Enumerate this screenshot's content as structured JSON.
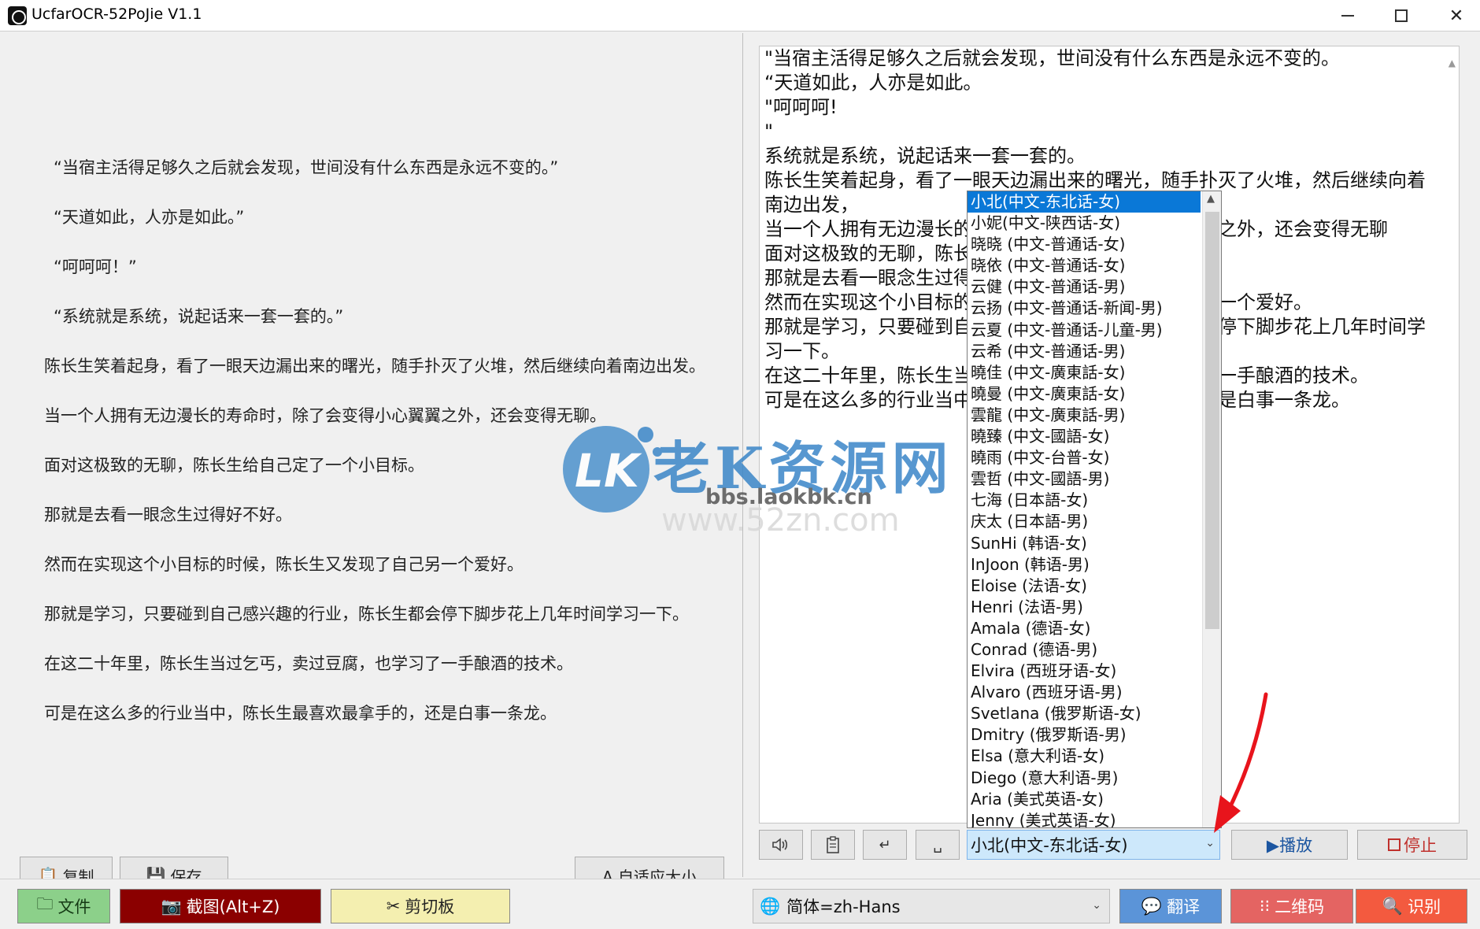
{
  "window": {
    "title": "UcfarOCR-52PoJie V1.1",
    "controls": [
      "minimize",
      "maximize",
      "close"
    ]
  },
  "left_panel": {
    "paragraphs": [
      "“当宿主活得足够久之后就会发现，世间没有什么东西是永远不变的。”",
      "“天道如此，人亦是如此。”",
      "“呵呵呵！”",
      "“系统就是系统，说起话来一套一套的。”",
      "陈长生笑着起身，看了一眼天边漏出来的曙光，随手扑灭了火堆，然后继续向着南边出发。",
      "当一个人拥有无边漫长的寿命时，除了会变得小心翼翼之外，还会变得无聊。",
      "面对这极致的无聊，陈长生给自己定了一个小目标。",
      "那就是去看一眼念生过得好不好。",
      "然而在实现这个小目标的时候，陈长生又发现了自己另一个爱好。",
      "那就是学习，只要碰到自己感兴趣的行业，陈长生都会停下脚步花上几年时间学习一下。",
      "在这二十年里，陈长生当过乞丐，卖过豆腐，也学习了一手酿酒的技术。",
      "可是在这么多的行业当中，陈长生最喜欢最拿手的，还是白事一条龙。"
    ],
    "buttons": {
      "copy": "复制",
      "save": "保存",
      "more": "...",
      "autofit": "A 自适应大小"
    }
  },
  "right_panel": {
    "lines": [
      "\"当宿主活得足够久之后就会发现，世间没有什么东西是永远不变的。",
      "“天道如此，人亦是如此。",
      "\"呵呵呵!",
      "\"",
      "系统就是系统，说起话来一套一套的。",
      "陈长生笑着起身，看了一眼天边漏出来的曙光，随手扑灭了火堆，然后继续向着",
      "南边出发，",
      "当一个人拥有无边漫长的寿命时，除了会变得小心翼翼之外，还会变得无聊",
      "面对这极致的无聊，陈长生给自己定了一个小目标。",
      "那就是去看一眼念生过得好不好。",
      "然而在实现这个小目标的时候，陈长生又发现了自己另一个爱好。",
      "那就是学习，只要碰到自己感兴趣的行业，陈长生都会停下脚步花上几年时间学",
      "习一下。",
      "在这二十年里，陈长生当过乞丐，卖过豆腐，也学习了一手酿酒的技术。",
      "可是在这么多的行业当中，陈长生最喜欢最拿手的，还是白事一条龙。"
    ],
    "toolbar": {
      "speaker_icon": "speaker-icon",
      "clipboard_icon": "clipboard-icon",
      "enter_glyph": "↵",
      "space_glyph": "␣",
      "voice_selected": "小北(中文-东北话-女)",
      "play": "▶播放",
      "stop": "停止"
    },
    "voice_options": [
      "小北(中文-东北话-女)",
      "小妮(中文-陕西话-女)",
      "晓晓 (中文-普通话-女)",
      "晓依 (中文-普通话-女)",
      "云健 (中文-普通话-男)",
      "云扬 (中文-普通话-新闻-男)",
      "云夏 (中文-普通话-儿童-男)",
      "云希 (中文-普通话-男)",
      "曉佳 (中文-廣東話-女)",
      "曉曼 (中文-廣東話-女)",
      "雲龍 (中文-廣東話-男)",
      "曉臻 (中文-國語-女)",
      "曉雨 (中文-台普-女)",
      "雲哲 (中文-國語-男)",
      "七海 (日本語-女)",
      "庆太 (日本語-男)",
      "SunHi (韩语-女)",
      "InJoon (韩语-男)",
      "Eloise (法语-女)",
      "Henri (法语-男)",
      "Amala (德语-女)",
      "Conrad (德语-男)",
      "Elvira (西班牙语-女)",
      "Alvaro (西班牙语-男)",
      "Svetlana (俄罗斯语-女)",
      "Dmitry (俄罗斯语-男)",
      "Elsa (意大利语-女)",
      "Diego (意大利语-男)",
      "Aria (美式英语-女)",
      "Jenny (美式英语-女)"
    ]
  },
  "watermark": {
    "logo": "LK",
    "name": "老K资源网",
    "url": "bbs.laokbk.cn",
    "url2": "www.52zn.com"
  },
  "bottom_bar": {
    "file": "文件",
    "screenshot": "截图(Alt+Z)",
    "clipboard": "剪切板",
    "language": "简体=zh-Hans",
    "translate": "翻译",
    "qrcode": "二维码",
    "recognize": "识别"
  },
  "colors": {
    "selection": "#0a78d7",
    "file_btn": "#8cd08a",
    "screenshot_btn": "#8b0000",
    "clipboard_btn": "#f4efb0",
    "translate_btn": "#5b94d8",
    "qrcode_btn": "#e46462",
    "recognize_btn": "#f35a3f",
    "annotation_arrow": "#e8141c"
  }
}
